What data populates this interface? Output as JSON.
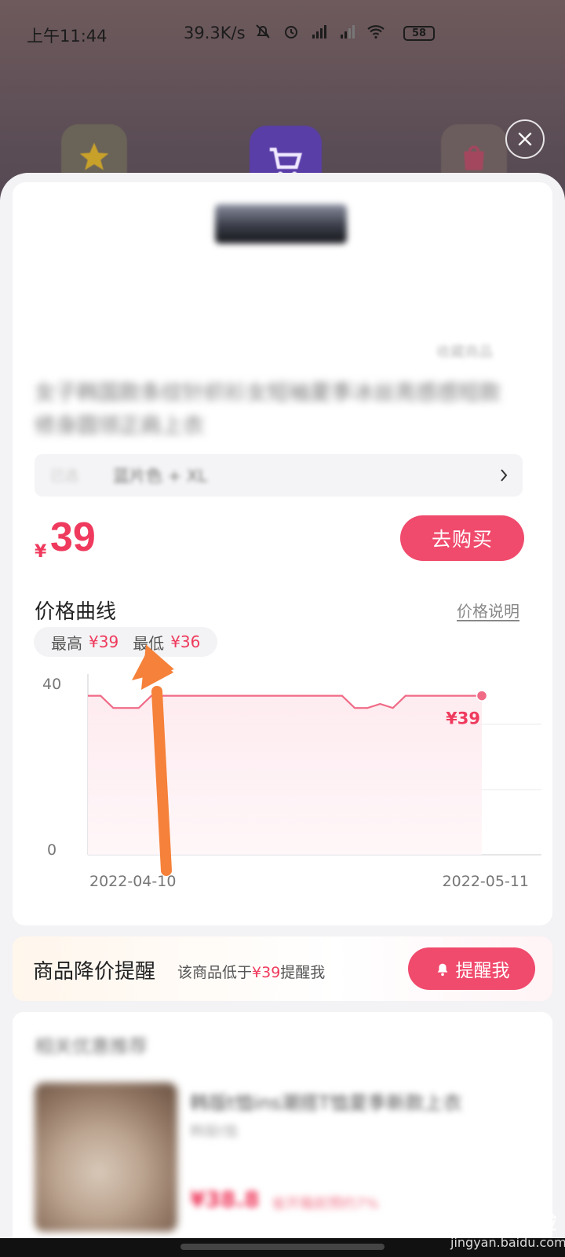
{
  "status_bar": {
    "time": "上午11:44",
    "speed": "39.3K/s",
    "battery": "58"
  },
  "product": {
    "title_blurred": "女子韩国款条纹针织衫女短袖夏季冰丝亮感感短款修身圆领正肩上衣",
    "fav_blurred": "收藏商品",
    "sku_tag_blurred": "已选",
    "sku_value_blurred": "蓝片色 + XL",
    "currency": "¥",
    "price": "39",
    "buy_label": "去购买"
  },
  "price_curve": {
    "title": "价格曲线",
    "help_label": "价格说明",
    "highest_label": "最高",
    "highest_value": "¥39",
    "lowest_label": "最低",
    "lowest_value": "¥36"
  },
  "chart_data": {
    "type": "line",
    "x_start_label": "2022-04-10",
    "x_end_label": "2022-05-11",
    "y_ticks": [
      "40",
      "0"
    ],
    "ylim": [
      0,
      40
    ],
    "series": [
      {
        "values": [
          39,
          39,
          36,
          36,
          36,
          39,
          39,
          39,
          39,
          39,
          39,
          39,
          39,
          39,
          39,
          39,
          39,
          39,
          39,
          39,
          39,
          36,
          36,
          37,
          36,
          39,
          39,
          39,
          39,
          39,
          39,
          39
        ]
      }
    ],
    "end_label": "¥39",
    "line_color": "#f06a86",
    "fill_color": "#fde9ee"
  },
  "reminder": {
    "title": "商品降价提醒",
    "desc_prefix": "该商品低于",
    "desc_price": "¥39",
    "desc_suffix": "提醒我",
    "button_label": "提醒我"
  },
  "recommend": {
    "title_blurred": "相关优惠推荐",
    "item_name_blurred": "韩版t恤ins潮搭T恤夏季新款上衣",
    "item_sub_blurred": "韩版t恤",
    "item_price_blurred": "¥38.8",
    "item_coupon_blurred": "省开箱前预约7%"
  },
  "watermark": {
    "main": "Baidu经验",
    "sub": "jingyan.baidu.com"
  },
  "colors": {
    "accent": "#f04a6c",
    "price_red": "#ef3a5d"
  }
}
